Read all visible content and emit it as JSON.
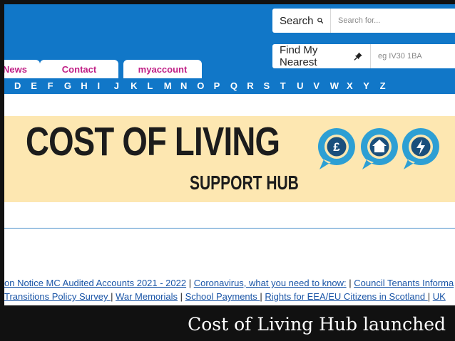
{
  "header": {
    "search": {
      "button_label": "Search",
      "placeholder": "Search for..."
    },
    "find_nearest": {
      "button_label": "Find My Nearest",
      "placeholder": "eg IV30 1BA"
    },
    "tabs": [
      {
        "label": "News"
      },
      {
        "label": "Contact"
      },
      {
        "label": "myaccount"
      }
    ]
  },
  "alphabet": [
    "D",
    "E",
    "F",
    "G",
    "H",
    "I",
    "J",
    "K",
    "L",
    "M",
    "N",
    "O",
    "P",
    "Q",
    "R",
    "S",
    "T",
    "U",
    "V",
    "W",
    "X",
    "Y",
    "Z"
  ],
  "banner": {
    "title": "COST OF LIVING",
    "subtitle": "SUPPORT HUB",
    "icons": [
      "pound-icon",
      "house-icon",
      "lightning-icon"
    ],
    "colors": {
      "background": "#fde7b1",
      "bubble": "#2d9fd4",
      "bubble_inner": "#1a4f7c"
    }
  },
  "quick_links": {
    "line1_prefix": "on Notice MC Audited Accounts 2021 - 2022",
    "line1": [
      "Coronavirus, what you need to know:",
      "Council Tenants Informa"
    ],
    "line2": [
      "Transitions Policy Survey ",
      "War Memorials",
      "School Payments ",
      "Rights for EEA/EU Citizens in Scotland ",
      "UK"
    ]
  },
  "caption": "Cost of Living Hub launched",
  "colors": {
    "header_blue": "#1177c8",
    "tab_text": "#c01f86",
    "link": "#1a55a7"
  }
}
